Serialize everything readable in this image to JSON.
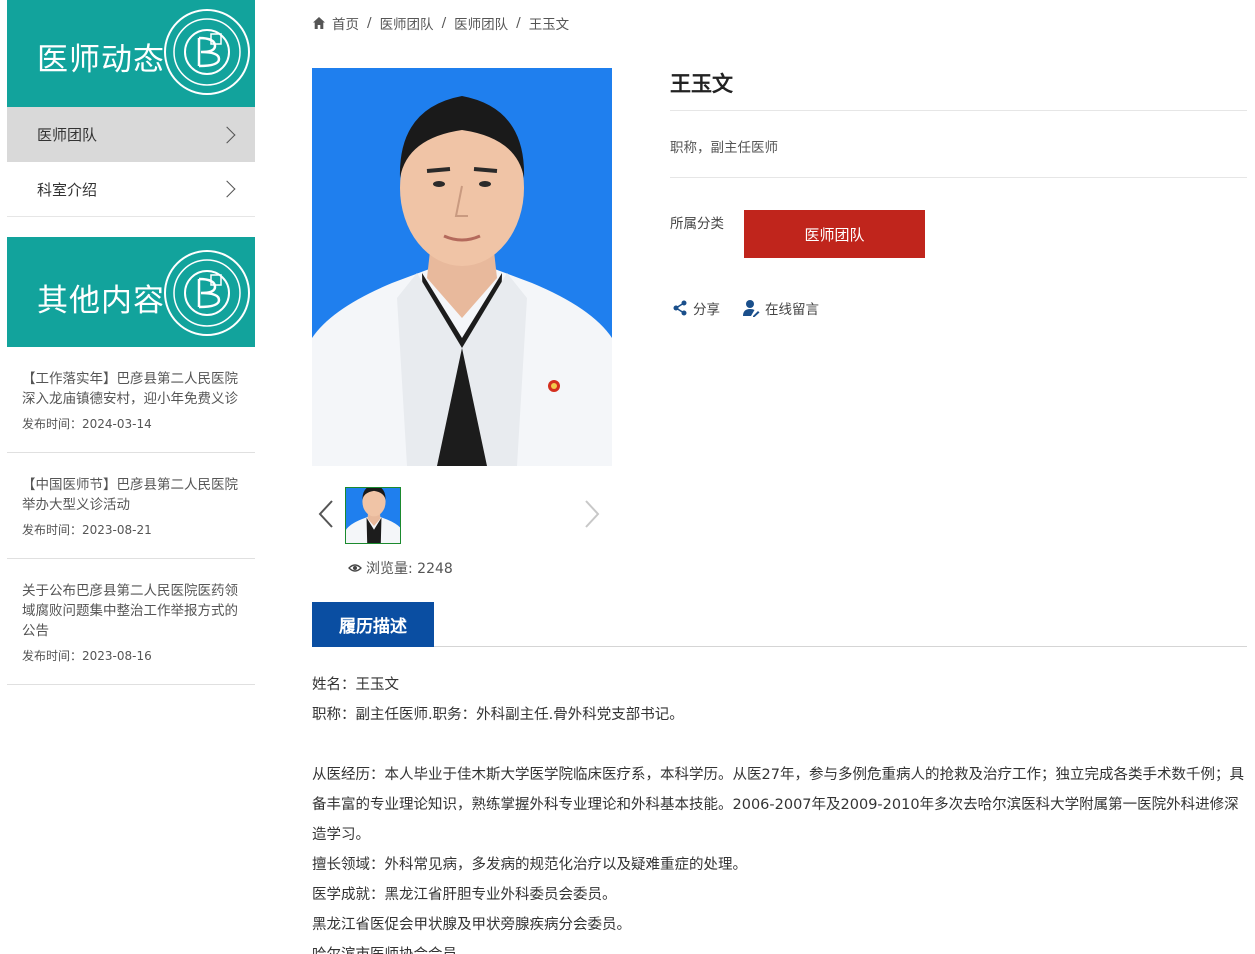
{
  "sidebar": {
    "banner1_title": "医师动态",
    "menu": [
      {
        "label": "医师团队",
        "active": true
      },
      {
        "label": "科室介绍",
        "active": false
      }
    ],
    "banner2_title": "其他内容",
    "news": [
      {
        "title": "【工作落实年】巴彦县第二人民医院深入龙庙镇德安村，迎小年免费义诊",
        "date": "发布时间：2024-03-14"
      },
      {
        "title": "【中国医师节】巴彦县第二人民医院举办大型义诊活动",
        "date": "发布时间：2023-08-21"
      },
      {
        "title": "关于公布巴彦县第二人民医院医药领域腐败问题集中整治工作举报方式的公告",
        "date": "发布时间：2023-08-16"
      }
    ]
  },
  "breadcrumb": [
    "首页",
    "医师团队",
    "医师团队",
    "王玉文"
  ],
  "doctor": {
    "name": "王玉文",
    "job_title": "职称，副主任医师",
    "category_label": "所属分类",
    "category_button": "医师团队",
    "share_label": "分享",
    "message_label": "在线留言",
    "views_label": "浏览量: 2248"
  },
  "tab_label": "履历描述",
  "description": [
    "姓名：王玉文",
    "职称：副主任医师.职务：外科副主任.骨外科党支部书记。",
    "",
    "从医经历：本人毕业于佳木斯大学医学院临床医疗系，本科学历。从医27年，参与多例危重病人的抢救及治疗工作；独立完成各类手术数千例；具备丰富的专业理论知识，熟练掌握外科专业理论和外科基本技能。2006-2007年及2009-2010年多次去哈尔滨医科大学附属第一医院外科进修深造学习。",
    "擅长领域：外科常见病，多发病的规范化治疗以及疑难重症的处理。",
    "医学成就：黑龙江省肝胆专业外科委员会委员。",
    "黑龙江省医促会甲状腺及甲状旁腺疾病分会委员。",
    "哈尔滨市医师协会会员"
  ],
  "colors": {
    "banner": "#12a39c",
    "category_button": "#c0251c",
    "tab": "#0a4ea2",
    "photo_bg": "#1f7fee"
  }
}
